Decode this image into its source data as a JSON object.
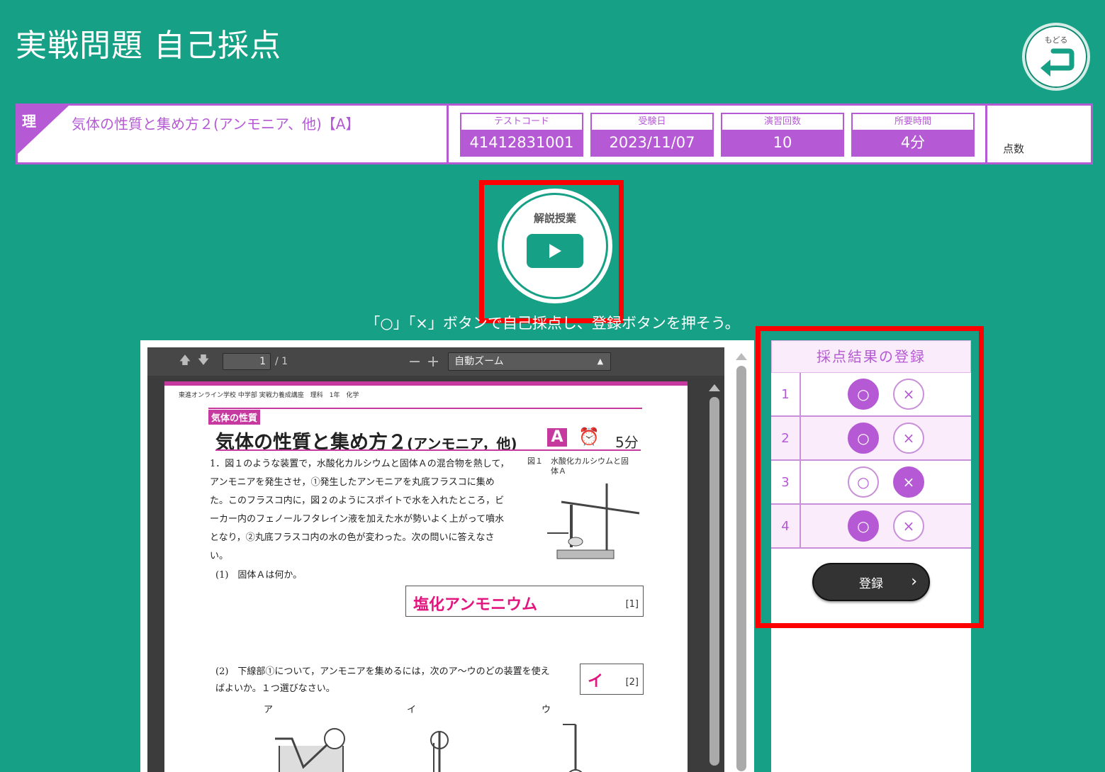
{
  "page_title": "実戦問題 自己採点",
  "back_button": {
    "label": "もどる",
    "icon": "return-arrow-icon"
  },
  "test": {
    "subject_code": "理",
    "title": "気体の性質と集め方２(アンモニア、他)【A】",
    "meta": [
      {
        "key": "テストコード",
        "value": "41412831001"
      },
      {
        "key": "受験日",
        "value": "2023/11/07"
      },
      {
        "key": "演習回数",
        "value": "10"
      },
      {
        "key": "所要時間",
        "value": "4分"
      }
    ],
    "score_label": "点数"
  },
  "video_button": {
    "label": "解説授業",
    "icon": "play-icon"
  },
  "instruction": "「○」「×」ボタンで自己採点し、登録ボタンを押そう。",
  "pdf_viewer": {
    "page_current": "1",
    "page_total": "/ 1",
    "zoom": "自動ズーム",
    "document": {
      "header": "東進オンライン学校 中学部 実戦力養成講座　理科　1年　化学",
      "category": "気体の性質",
      "title_main": "気体の性質と集め方２",
      "title_sub": "(アンモニア，他)",
      "level": "A",
      "time": "5分",
      "q1_text": "1．図１のような装置で，水酸化カルシウムと固体Ａの混合物を熱して，アンモニアを発生させ，①発生したアンモニアを丸底フラスコに集めた。このフラスコ内に，図２のようにスポイトで水を入れたところ，ビーカー内のフェノールフタレイン液を加えた水が勢いよく上がって噴水となり，②丸底フラスコ内の水の色が変わった。次の問いに答えなさい。",
      "figure_label": "図１",
      "figure_caption": "水酸化カルシウムと固体Ａ",
      "q1_1": "(1)　固体Ａは何か。",
      "q1_1_answer": "塩化アンモニウム",
      "q1_1_points": "[1]",
      "q1_2": "(2)　下線部①について，アンモニアを集めるには，次のア～ウのどの装置を使えばよいか。１つ選びなさい。",
      "q1_2_answer": "イ",
      "q1_2_points": "[2]",
      "options": [
        "ア",
        "イ",
        "ウ"
      ]
    }
  },
  "grading": {
    "title": "採点結果の登録",
    "correct_symbol": "○",
    "wrong_symbol": "×",
    "rows": [
      {
        "num": "1",
        "selected": "correct"
      },
      {
        "num": "2",
        "selected": "correct"
      },
      {
        "num": "3",
        "selected": "wrong"
      },
      {
        "num": "4",
        "selected": "correct"
      }
    ],
    "register_label": "登録"
  },
  "colors": {
    "background": "#16a085",
    "accent": "#b559d4",
    "highlight": "#ff0000",
    "answer": "#e2157f"
  }
}
